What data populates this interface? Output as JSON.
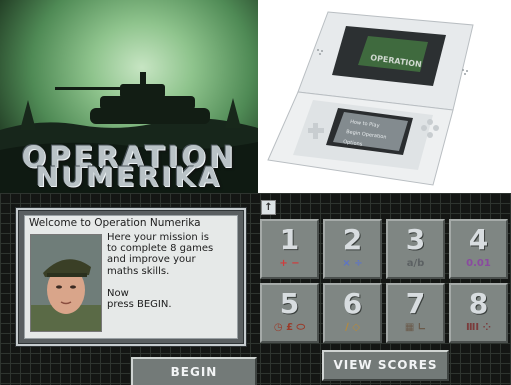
{
  "title_art": {
    "line1": "OPERATION",
    "line2": "NUMERIKA"
  },
  "console_photo": {
    "screen_lines": [
      "OPERATION",
      "How to Play",
      "Begin Operation",
      "Options"
    ]
  },
  "welcome": {
    "title": "Welcome to Operation Numerika",
    "message": "Here your mission is\nto complete 8 games\nand improve your\nmaths skills.\n\nNow\npress BEGIN."
  },
  "games": [
    {
      "number": "1",
      "subtitle": "+ −",
      "subtitle_color": "#d23b3b"
    },
    {
      "number": "2",
      "subtitle": "× ÷",
      "subtitle_color": "#5d74c7"
    },
    {
      "number": "3",
      "subtitle": "a/b",
      "subtitle_color": "#5c6163"
    },
    {
      "number": "4",
      "subtitle": "0.01",
      "subtitle_color": "#8a4aa0"
    },
    {
      "number": "5",
      "subtitle": "◷ £ ⬭",
      "subtitle_color": "#9a3b2a"
    },
    {
      "number": "6",
      "subtitle": "∕ ◇",
      "subtitle_color": "#b78a3a"
    },
    {
      "number": "7",
      "subtitle": "▦ ∟",
      "subtitle_color": "#6a5a4a"
    },
    {
      "number": "8",
      "subtitle": "ⅢⅠ ⁘",
      "subtitle_color": "#7a3b3b"
    }
  ],
  "buttons": {
    "begin": "BEGIN",
    "view_scores": "VIEW SCORES",
    "up_arrow": "↑"
  },
  "colors": {
    "title_green": "#8fc48d",
    "panel_gray": "#5a5f61",
    "grid_dark": "#141614"
  }
}
